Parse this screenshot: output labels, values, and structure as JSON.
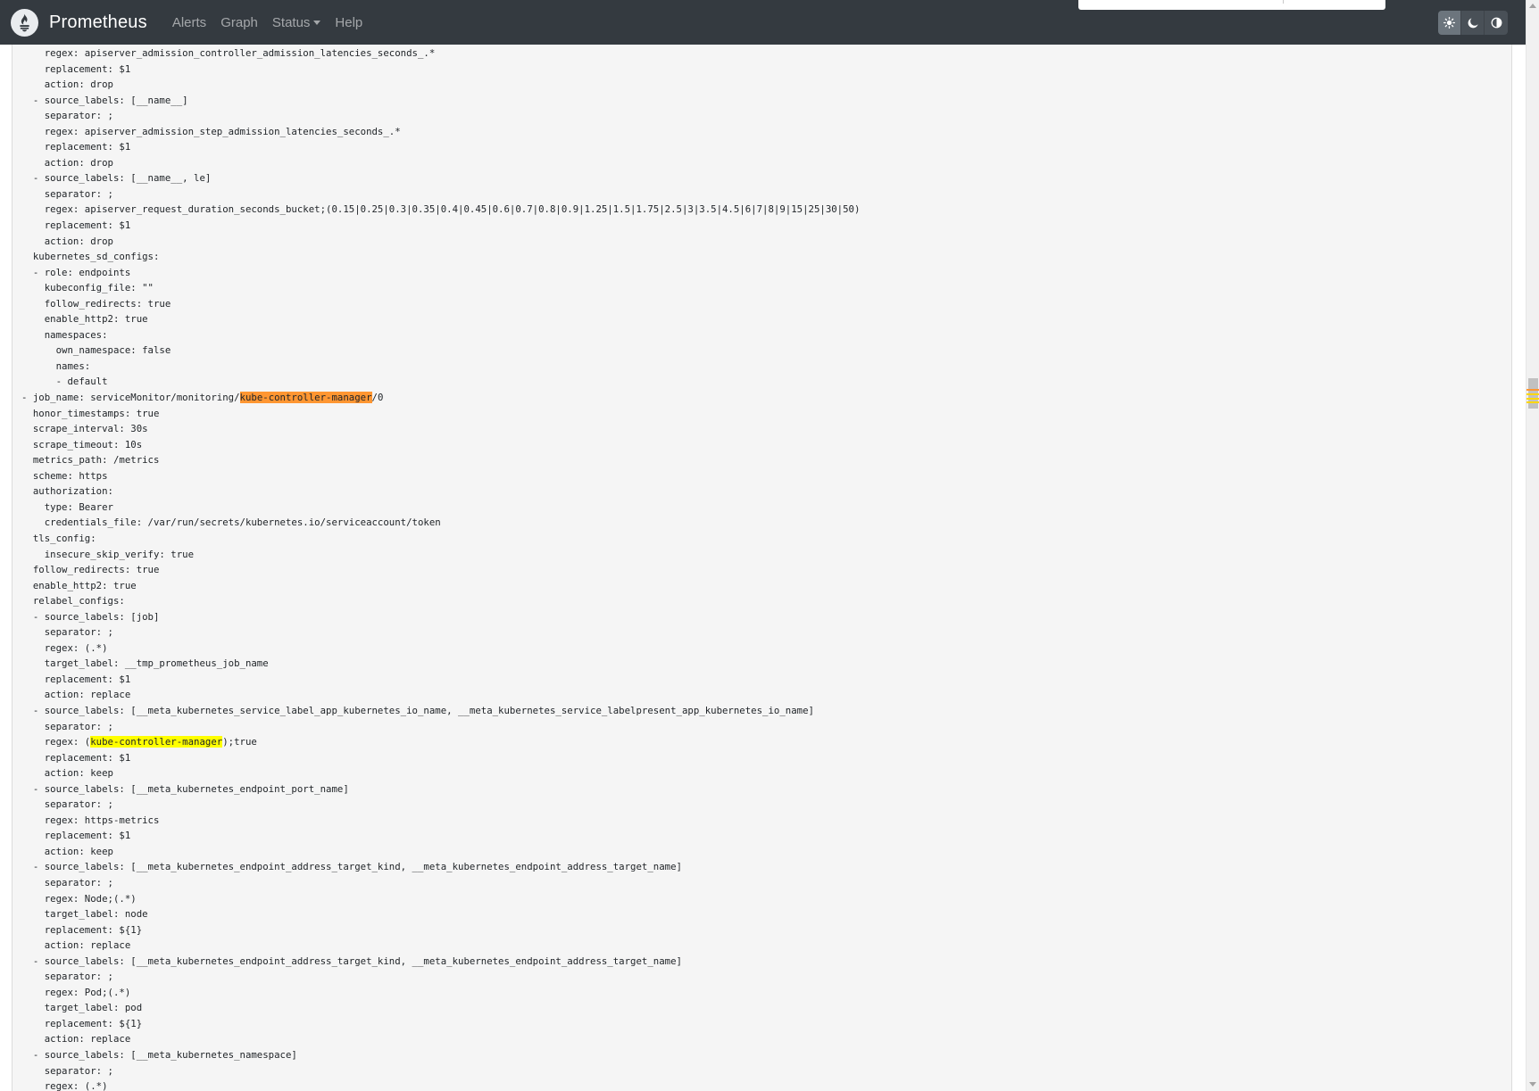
{
  "navbar": {
    "brand": "Prometheus",
    "links": [
      {
        "label": "Alerts"
      },
      {
        "label": "Graph"
      },
      {
        "label": "Status",
        "dropdown": true
      },
      {
        "label": "Help"
      }
    ],
    "theme_options": [
      "light-theme-icon",
      "dark-theme-icon",
      "browser-default-theme-icon"
    ],
    "active_theme": "light-theme-icon"
  },
  "colors": {
    "navbar_bg": "#343a40",
    "page_bg": "#f5f5f5",
    "current_match": "#ff9632",
    "other_match": "#ffff00"
  },
  "config_lines": [
    {
      "text": "    regex: apiserver_admission_controller_admission_latencies_seconds_.*"
    },
    {
      "text": "    replacement: $1"
    },
    {
      "text": "    action: drop"
    },
    {
      "text": "  - source_labels: [__name__]"
    },
    {
      "text": "    separator: ;"
    },
    {
      "text": "    regex: apiserver_admission_step_admission_latencies_seconds_.*"
    },
    {
      "text": "    replacement: $1"
    },
    {
      "text": "    action: drop"
    },
    {
      "text": "  - source_labels: [__name__, le]"
    },
    {
      "text": "    separator: ;"
    },
    {
      "text": "    regex: apiserver_request_duration_seconds_bucket;(0.15|0.25|0.3|0.35|0.4|0.45|0.6|0.7|0.8|0.9|1.25|1.5|1.75|2.5|3|3.5|4.5|6|7|8|9|15|25|30|50)"
    },
    {
      "text": "    replacement: $1"
    },
    {
      "text": "    action: drop"
    },
    {
      "text": "  kubernetes_sd_configs:"
    },
    {
      "text": "  - role: endpoints"
    },
    {
      "text": "    kubeconfig_file: \"\""
    },
    {
      "text": "    follow_redirects: true"
    },
    {
      "text": "    enable_http2: true"
    },
    {
      "text": "    namespaces:"
    },
    {
      "text": "      own_namespace: false"
    },
    {
      "text": "      names:"
    },
    {
      "text": "      - default"
    },
    {
      "before": "- job_name: serviceMonitor/monitoring/",
      "highlight": "kube-controller-manager",
      "after": "/0",
      "kind": "current"
    },
    {
      "text": "  honor_timestamps: true"
    },
    {
      "text": "  scrape_interval: 30s"
    },
    {
      "text": "  scrape_timeout: 10s"
    },
    {
      "text": "  metrics_path: /metrics"
    },
    {
      "text": "  scheme: https"
    },
    {
      "text": "  authorization:"
    },
    {
      "text": "    type: Bearer"
    },
    {
      "text": "    credentials_file: /var/run/secrets/kubernetes.io/serviceaccount/token"
    },
    {
      "text": "  tls_config:"
    },
    {
      "text": "    insecure_skip_verify: true"
    },
    {
      "text": "  follow_redirects: true"
    },
    {
      "text": "  enable_http2: true"
    },
    {
      "text": "  relabel_configs:"
    },
    {
      "text": "  - source_labels: [job]"
    },
    {
      "text": "    separator: ;"
    },
    {
      "text": "    regex: (.*)"
    },
    {
      "text": "    target_label: __tmp_prometheus_job_name"
    },
    {
      "text": "    replacement: $1"
    },
    {
      "text": "    action: replace"
    },
    {
      "text": "  - source_labels: [__meta_kubernetes_service_label_app_kubernetes_io_name, __meta_kubernetes_service_labelpresent_app_kubernetes_io_name]"
    },
    {
      "text": "    separator: ;"
    },
    {
      "before": "    regex: (",
      "highlight": "kube-controller-manager",
      "after": ");true",
      "kind": "match"
    },
    {
      "text": "    replacement: $1"
    },
    {
      "text": "    action: keep"
    },
    {
      "text": "  - source_labels: [__meta_kubernetes_endpoint_port_name]"
    },
    {
      "text": "    separator: ;"
    },
    {
      "text": "    regex: https-metrics"
    },
    {
      "text": "    replacement: $1"
    },
    {
      "text": "    action: keep"
    },
    {
      "text": "  - source_labels: [__meta_kubernetes_endpoint_address_target_kind, __meta_kubernetes_endpoint_address_target_name]"
    },
    {
      "text": "    separator: ;"
    },
    {
      "text": "    regex: Node;(.*)"
    },
    {
      "text": "    target_label: node"
    },
    {
      "text": "    replacement: ${1}"
    },
    {
      "text": "    action: replace"
    },
    {
      "text": "  - source_labels: [__meta_kubernetes_endpoint_address_target_kind, __meta_kubernetes_endpoint_address_target_name]"
    },
    {
      "text": "    separator: ;"
    },
    {
      "text": "    regex: Pod;(.*)"
    },
    {
      "text": "    target_label: pod"
    },
    {
      "text": "    replacement: ${1}"
    },
    {
      "text": "    action: replace"
    },
    {
      "text": "  - source_labels: [__meta_kubernetes_namespace]"
    },
    {
      "text": "    separator: ;"
    },
    {
      "text": "    regex: (.*)"
    }
  ]
}
